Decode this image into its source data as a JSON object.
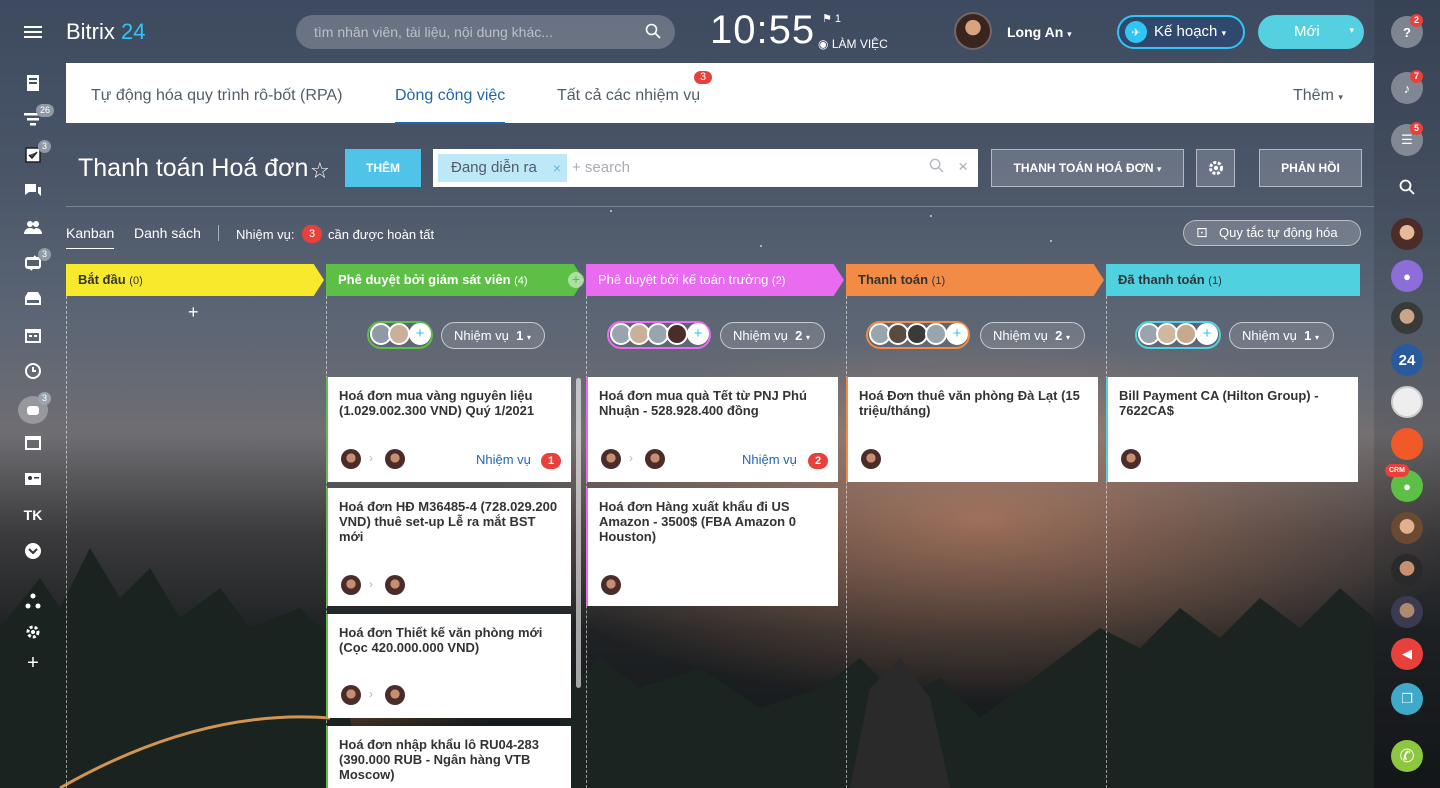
{
  "header": {
    "logo_main": "Bitrix",
    "logo_num": "24",
    "search_placeholder": "tìm nhân viên, tài liệu, nội dung khác...",
    "clock": "10:55",
    "flag_count": "1",
    "work_status": "LÀM VIỆC",
    "user_name": "Long An",
    "plan_label": "Kế hoạch",
    "new_label": "Mới"
  },
  "left_sidebar": {
    "badges": {
      "filter": "26",
      "tasks": "3",
      "sync": "3",
      "bot": "3"
    },
    "tk_label": "TK"
  },
  "right_sidebar": {
    "help_badge": "2",
    "bell_badge": "7",
    "chat_badge": "5",
    "b24_label": "24",
    "crm_label": "CRM"
  },
  "tabs": [
    {
      "label": "Tự động hóa quy trình rô-bốt (RPA)"
    },
    {
      "label": "Dòng công việc"
    },
    {
      "label": "Tất cả các nhiệm vụ"
    }
  ],
  "tabs_badge": "3",
  "tabs_more": "Thêm",
  "page": {
    "title": "Thanh toán Hoá đơn",
    "add_label": "THÊM",
    "filter_chip": "Đang diễn ra",
    "filter_placeholder": "+ search",
    "workflow_select": "THANH TOÁN HOÁ ĐƠN",
    "feedback": "PHẢN HỒI"
  },
  "view": {
    "kanban": "Kanban",
    "list": "Danh sách",
    "tasks_prefix": "Nhiệm vụ:",
    "tasks_count": "3",
    "tasks_suffix": "cần được hoàn tất",
    "automation_rules": "Quy tắc tự động hóa"
  },
  "colors": {
    "col1": "#f7ea2c",
    "col2": "#5dbf45",
    "col3": "#e96bf0",
    "col4": "#f28b45",
    "col5": "#4fd1e0"
  },
  "columns": [
    {
      "name": "Bắt đầu",
      "count": "(0)",
      "add": "+"
    },
    {
      "name": "Phê duyệt bởi giám sát viên",
      "count": "(4)",
      "task_label": "Nhiệm vụ",
      "task_count": "1"
    },
    {
      "name": "Phê duyệt bởi kế toán trưởng",
      "count": "(2)",
      "task_label": "Nhiệm vụ",
      "task_count": "2"
    },
    {
      "name": "Thanh toán",
      "count": "(1)",
      "task_label": "Nhiệm vụ",
      "task_count": "2"
    },
    {
      "name": "Đã thanh toán",
      "count": "(1)",
      "task_label": "Nhiệm vụ",
      "task_count": "1"
    }
  ],
  "cards": {
    "c2a": {
      "title": "Hoá đơn mua vàng nguyên liệu (1.029.002.300 VND) Quý 1/2021",
      "tasks": "Nhiệm vụ",
      "tasks_count": "1"
    },
    "c2b": {
      "title": "Hoá đơn HĐ M36485-4 (728.029.200 VND) thuê set-up Lễ ra mắt BST mới"
    },
    "c2c": {
      "title": "Hoá đơn Thiết kế văn phòng mới (Cọc 420.000.000 VND)"
    },
    "c2d": {
      "title": "Hoá đơn nhập khẩu lô RU04-283 (390.000 RUB - Ngân hàng VTB Moscow)"
    },
    "c3a": {
      "title": "Hoá đơn mua quà Tết từ PNJ Phú Nhuận - 528.928.400 đồng",
      "tasks": "Nhiệm vụ",
      "tasks_count": "2"
    },
    "c3b": {
      "title": "Hoá đơn Hàng xuất khẩu đi US Amazon - 3500$ (FBA Amazon 0 Houston)"
    },
    "c4a": {
      "title": "Hoá Đơn thuê văn phòng Đà Lạt (15 triệu/tháng)"
    },
    "c5a": {
      "title": "Bill Payment CA (Hilton Group) - 7622CA$"
    }
  }
}
